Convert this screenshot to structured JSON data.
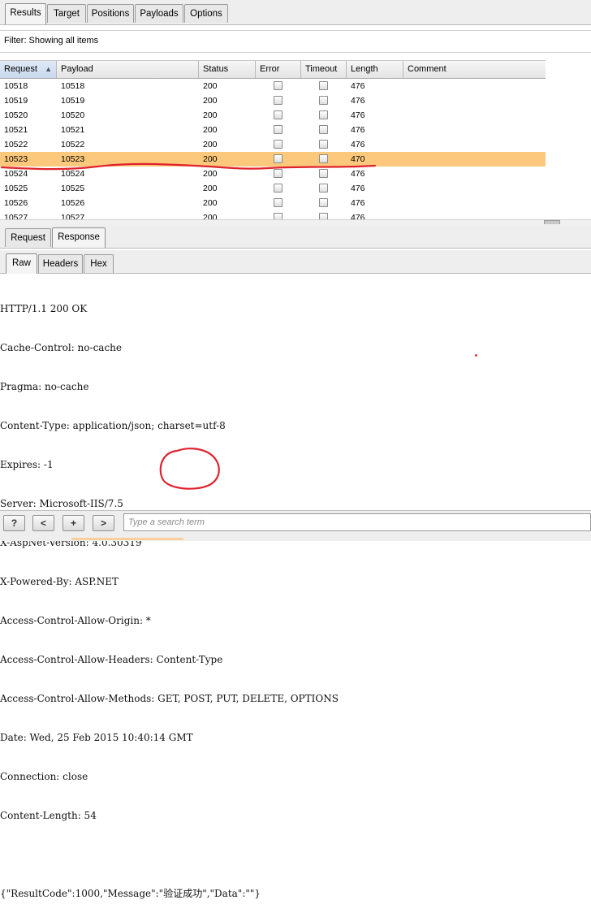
{
  "top_tabs": [
    "Results",
    "Target",
    "Positions",
    "Payloads",
    "Options"
  ],
  "filter": "Filter: Showing all items",
  "columns": [
    {
      "label": "Request",
      "sorted": "asc"
    },
    {
      "label": "Payload"
    },
    {
      "label": "Status"
    },
    {
      "label": "Error"
    },
    {
      "label": "Timeout"
    },
    {
      "label": "Length"
    },
    {
      "label": "Comment"
    }
  ],
  "rows": [
    {
      "request": "10518",
      "payload": "10518",
      "status": "200",
      "length": "476"
    },
    {
      "request": "10519",
      "payload": "10519",
      "status": "200",
      "length": "476"
    },
    {
      "request": "10520",
      "payload": "10520",
      "status": "200",
      "length": "476"
    },
    {
      "request": "10521",
      "payload": "10521",
      "status": "200",
      "length": "476"
    },
    {
      "request": "10522",
      "payload": "10522",
      "status": "200",
      "length": "476"
    },
    {
      "request": "10523",
      "payload": "10523",
      "status": "200",
      "length": "470",
      "selected": true
    },
    {
      "request": "10524",
      "payload": "10524",
      "status": "200",
      "length": "476"
    },
    {
      "request": "10525",
      "payload": "10525",
      "status": "200",
      "length": "476"
    },
    {
      "request": "10526",
      "payload": "10526",
      "status": "200",
      "length": "476"
    },
    {
      "request": "10527",
      "payload": "10527",
      "status": "200",
      "length": "476"
    }
  ],
  "reqresp_tabs": [
    "Request",
    "Response"
  ],
  "view_tabs": [
    "Raw",
    "Headers",
    "Hex"
  ],
  "response_lines": [
    "HTTP/1.1 200 OK",
    "Cache-Control: no-cache",
    "Pragma: no-cache",
    "Content-Type: application/json; charset=utf-8",
    "Expires: -1",
    "Server: Microsoft-IIS/7.5",
    "X-AspNet-Version: 4.0.30319",
    "X-Powered-By: ASP.NET",
    "Access-Control-Allow-Origin: *",
    "Access-Control-Allow-Headers: Content-Type",
    "Access-Control-Allow-Methods: GET, POST, PUT, DELETE, OPTIONS",
    "Date: Wed, 25 Feb 2015 10:40:14 GMT",
    "Connection: close",
    "Content-Length: 54",
    "",
    "{\"ResultCode\":1000,\"Message\":\"验证成功\",\"Data\":\"\"}"
  ],
  "bottom_buttons": [
    "?",
    "<",
    "+",
    ">"
  ],
  "search_placeholder": "Type a search term",
  "colors": {
    "selected_row": "#fcc97c",
    "annotation": "#e0222c"
  }
}
